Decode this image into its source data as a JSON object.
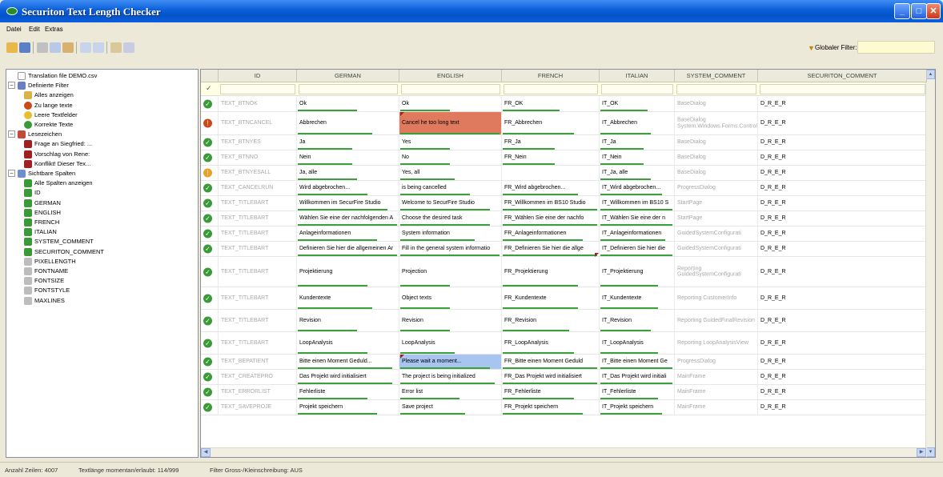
{
  "window": {
    "title": "Securiton Text Length Checker"
  },
  "menu": [
    "Datei",
    "Edit",
    "Extras"
  ],
  "toolbar": {
    "filter_label": "Globaler Filter:",
    "filter_value": ""
  },
  "tree": [
    {
      "label": "Translation file DEMO.csv",
      "level": 0,
      "icon": "document-icon",
      "expander": ""
    },
    {
      "label": "Definierte Filter",
      "level": 0,
      "icon": "funnel-icon",
      "expander": "−"
    },
    {
      "label": "Alles anzeigen",
      "level": 1,
      "icon": "broom-icon",
      "expander": ""
    },
    {
      "label": "Zu lange texte",
      "level": 1,
      "icon": "red-dot-icon",
      "expander": ""
    },
    {
      "label": "Leere Textfelder",
      "level": 1,
      "icon": "yellow-dot-icon",
      "expander": ""
    },
    {
      "label": "Korrekte Texte",
      "level": 1,
      "icon": "green-check-icon",
      "expander": ""
    },
    {
      "label": "Lesezeichen",
      "level": 0,
      "icon": "bookmarks-icon",
      "expander": "−"
    },
    {
      "label": "Frage an Siegfried: ...",
      "level": 1,
      "icon": "bookmark-icon",
      "expander": ""
    },
    {
      "label": "Vorschlag von Rene:",
      "level": 1,
      "icon": "bookmark-icon",
      "expander": ""
    },
    {
      "label": "Konflikt! Dieser Tex...",
      "level": 1,
      "icon": "bookmark-icon",
      "expander": ""
    },
    {
      "label": "Sichtbare Spalten",
      "level": 0,
      "icon": "columns-icon",
      "expander": "−"
    },
    {
      "label": "Alle Spalten anzeigen",
      "level": 1,
      "icon": "checked-box-icon",
      "expander": ""
    },
    {
      "label": "ID",
      "level": 1,
      "icon": "checked-box-icon",
      "expander": ""
    },
    {
      "label": "GERMAN",
      "level": 1,
      "icon": "checked-box-icon",
      "expander": ""
    },
    {
      "label": "ENGLISH",
      "level": 1,
      "icon": "checked-box-icon",
      "expander": ""
    },
    {
      "label": "FRENCH",
      "level": 1,
      "icon": "checked-box-icon",
      "expander": ""
    },
    {
      "label": "ITALIAN",
      "level": 1,
      "icon": "checked-box-icon",
      "expander": ""
    },
    {
      "label": "SYSTEM_COMMENT",
      "level": 1,
      "icon": "checked-box-icon",
      "expander": ""
    },
    {
      "label": "SECURITON_COMMENT",
      "level": 1,
      "icon": "checked-box-icon",
      "expander": ""
    },
    {
      "label": "PIXELLENGTH",
      "level": 1,
      "icon": "unchecked-box-icon",
      "expander": ""
    },
    {
      "label": "FONTNAME",
      "level": 1,
      "icon": "unchecked-box-icon",
      "expander": ""
    },
    {
      "label": "FONTSIZE",
      "level": 1,
      "icon": "unchecked-box-icon",
      "expander": ""
    },
    {
      "label": "FONTSTYLE",
      "level": 1,
      "icon": "unchecked-box-icon",
      "expander": ""
    },
    {
      "label": "MAXLINES",
      "level": 1,
      "icon": "unchecked-box-icon",
      "expander": ""
    }
  ],
  "grid": {
    "columns": [
      "ID",
      "GERMAN",
      "ENGLISH",
      "FRENCH",
      "ITALIAN",
      "SYSTEM_COMMENT",
      "SECURITON_COMMENT"
    ],
    "filter_row_marker": "✓",
    "rows": [
      {
        "status": "ok",
        "id": "TEXT_BTNOK",
        "german": "Ok",
        "english": "Ok",
        "french": "FR_OK",
        "italian": "IT_OK",
        "system": "BaseDialog",
        "securiton": "D_R_E_R"
      },
      {
        "status": "error",
        "id": "TEXT_BTNCANCEL",
        "german": "Abbrechen",
        "english": "Cancel he too long text",
        "french": "FR_Abbrechen",
        "italian": "IT_Abbrechen",
        "system": "BaseDialog System.Windows.Forms.Control",
        "securiton": "D_R_E_R"
      },
      {
        "status": "ok",
        "id": "TEXT_BTNYES",
        "german": "Ja",
        "english": "Yes",
        "french": "FR_Ja",
        "italian": "IT_Ja",
        "system": "BaseDialog",
        "securiton": "D_R_E_R"
      },
      {
        "status": "ok",
        "id": "TEXT_BTNNO",
        "german": "Nein",
        "english": "No",
        "french": "FR_Nein",
        "italian": "IT_Nein",
        "system": "BaseDialog",
        "securiton": "D_R_E_R"
      },
      {
        "status": "warn",
        "id": "TEXT_BTNYESALL",
        "german": "Ja, alle",
        "english": "Yes, all",
        "french": "",
        "italian": "IT_Ja, alle",
        "system": "BaseDialog",
        "securiton": "D_R_E_R"
      },
      {
        "status": "ok",
        "id": "TEXT_CANCELRUN",
        "german": "Wird abgebrochen...",
        "english": "is being cancelled",
        "french": "FR_Wird abgebrochen...",
        "italian": "IT_Wird abgebrochen...",
        "system": "ProgressDialog",
        "securiton": "D_R_E_R"
      },
      {
        "status": "ok",
        "id": "TEXT_TITLEBART",
        "german": "Willkommen im SecurFire Studio",
        "english": "Welcome to SecurFire Studio",
        "french": "FR_Willkommen im BS10 Studio",
        "italian": "IT_Willkommen im BS10 S",
        "system": "StartPage",
        "securiton": "D_R_E_R"
      },
      {
        "status": "ok",
        "id": "TEXT_TITLEBART",
        "german": "Wählen Sie eine der nachfolgenden A",
        "english": "Choose the desired task",
        "french": "FR_Wählen Sie eine der nachfo",
        "italian": "IT_Wählen Sie eine der n",
        "system": "StartPage",
        "securiton": "D_R_E_R"
      },
      {
        "status": "ok",
        "id": "TEXT_TITLEBART",
        "german": "Anlageinformationen",
        "english": "System information",
        "french": "FR_Anlageinformationen",
        "italian": "IT_Anlageinformationen",
        "system": "GuidedSystemConfigurati",
        "securiton": "D_R_E_R"
      },
      {
        "status": "ok",
        "id": "TEXT_TITLEBART",
        "german": "Definieren Sie hier die allgemeinen Ar",
        "english": "Fill in the general system informatio",
        "french": "FR_Definieren Sie hier die allge",
        "italian": "IT_Definieren Sie hier die",
        "system": "GuidedSystemConfigurati",
        "securiton": "D_R_E_R"
      },
      {
        "status": "ok",
        "id": "TEXT_TITLEBART",
        "german": "Projektierung",
        "english": "Projection",
        "french": "FR_Projektierung",
        "italian": "IT_Projektierung",
        "system": "Reporting GuidedSystemConfigurati",
        "securiton": "D_R_E_R"
      },
      {
        "status": "ok",
        "id": "TEXT_TITLEBART",
        "german": "Kundentexte",
        "english": "Object texts",
        "french": "FR_Kundentexte",
        "italian": "IT_Kundentexte",
        "system": "Reporting CustomerInfo",
        "securiton": "D_R_E_R"
      },
      {
        "status": "ok",
        "id": "TEXT_TITLEBART",
        "german": "Revision",
        "english": "Revision",
        "french": "FR_Revision",
        "italian": "IT_Revision",
        "system": "Reporting GuidedFinalRevision",
        "securiton": "D_R_E_R"
      },
      {
        "status": "ok",
        "id": "TEXT_TITLEBART",
        "german": "LoopAnalysis",
        "english": "LoopAnalysis",
        "french": "FR_LoopAnalysis",
        "italian": "IT_LoopAnalysis",
        "system": "Reporting LoopAnalysisView",
        "securiton": "D_R_E_R"
      },
      {
        "status": "ok",
        "id": "TEXT_BEPATIENT",
        "german": "Bitte einen Moment Geduld...",
        "english": "Please wait a moment...",
        "french": "FR_Bitte einen Moment Geduld",
        "italian": "IT_Bitte einen Moment Ge",
        "system": "ProgressDialog",
        "securiton": "D_R_E_R"
      },
      {
        "status": "ok",
        "id": "TEXT_CREATEPRO",
        "german": "Das Projekt wird initialisiert",
        "english": "The project is being initialized",
        "french": "FR_Das Projekt wird initialisiert",
        "italian": "IT_Das Projekt wird initiali",
        "system": "MainFrame",
        "securiton": "D_R_E_R"
      },
      {
        "status": "ok",
        "id": "TEXT_ERRORLIST",
        "german": "Fehlerliste",
        "english": "Error list",
        "french": "FR_Fehlerliste",
        "italian": "IT_Fehlerliste",
        "system": "MainFrame",
        "securiton": "D_R_E_R"
      },
      {
        "status": "ok",
        "id": "TEXT_SAVEPROJE",
        "german": "Projekt speichern",
        "english": "Save project",
        "french": "FR_Projekt speichern",
        "italian": "IT_Projekt speichern",
        "system": "MainFrame",
        "securiton": "D_R_E_R"
      }
    ]
  },
  "statusbar": {
    "rows": "Anzahl Zeilen: 4007",
    "length": "Textlänge momentan/erlaubt: 114/999",
    "filter": "Filter Gross-/Kleinschreibung: AUS"
  },
  "colors": {
    "ok": "#3a9a37",
    "error": "#c94a1a",
    "warn": "#e6a12c",
    "too_long_cell": "#e07a5f",
    "selected_cell": "#a8c4f0",
    "length_bar": "#3aa03a"
  }
}
